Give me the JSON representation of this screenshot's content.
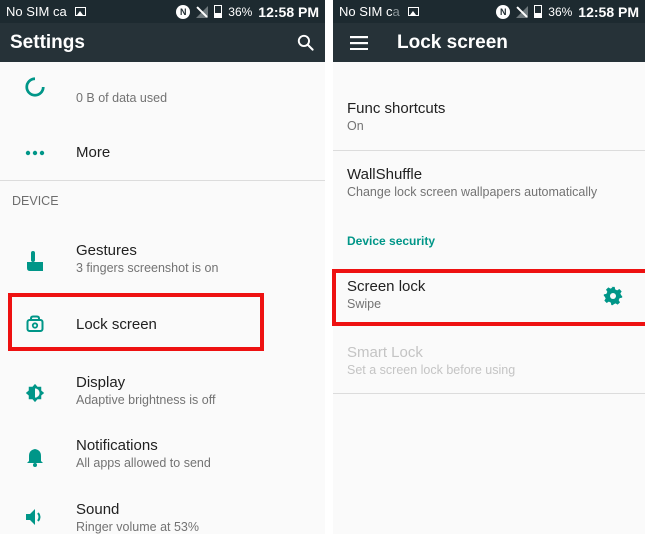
{
  "status_left": {
    "carrier_prefix": "No SIM ca",
    "carrier_faded": "",
    "battery": "36%",
    "time": "12:58 PM"
  },
  "status_right": {
    "carrier_prefix": "No SIM c",
    "carrier_faded": "a",
    "battery": "36%",
    "time": "12:58 PM"
  },
  "settings": {
    "title": "Settings",
    "items": [
      {
        "subtitle": "0 B of data used",
        "icon": "data-usage-icon"
      },
      {
        "title": "More",
        "icon": "more-dots-icon"
      },
      {
        "category": "DEVICE"
      },
      {
        "title": "Gestures",
        "subtitle": "3 fingers screenshot is on",
        "icon": "gesture-hand-icon"
      },
      {
        "title": "Lock screen",
        "icon": "lock-screen-icon"
      },
      {
        "title": "Display",
        "subtitle": "Adaptive brightness is off",
        "icon": "brightness-icon"
      },
      {
        "title": "Notifications",
        "subtitle": "All apps allowed to send",
        "icon": "bell-icon"
      },
      {
        "title": "Sound",
        "subtitle": "Ringer volume at 53%",
        "icon": "volume-icon"
      }
    ]
  },
  "lockscreen": {
    "title": "Lock screen",
    "items": [
      {
        "title": "Func shortcuts",
        "subtitle": "On"
      },
      {
        "title": "WallShuffle",
        "subtitle": "Change lock screen wallpapers automatically"
      },
      {
        "category": "Device security"
      },
      {
        "title": "Screen lock",
        "subtitle": "Swipe",
        "icon": "gear-icon"
      },
      {
        "title": "Smart Lock",
        "subtitle": "Set a screen lock before using",
        "disabled": true
      }
    ]
  },
  "colors": {
    "statusbar": "#1d2a30",
    "toolbar": "#263238",
    "accent": "#009688",
    "highlight": "#ee1111"
  }
}
